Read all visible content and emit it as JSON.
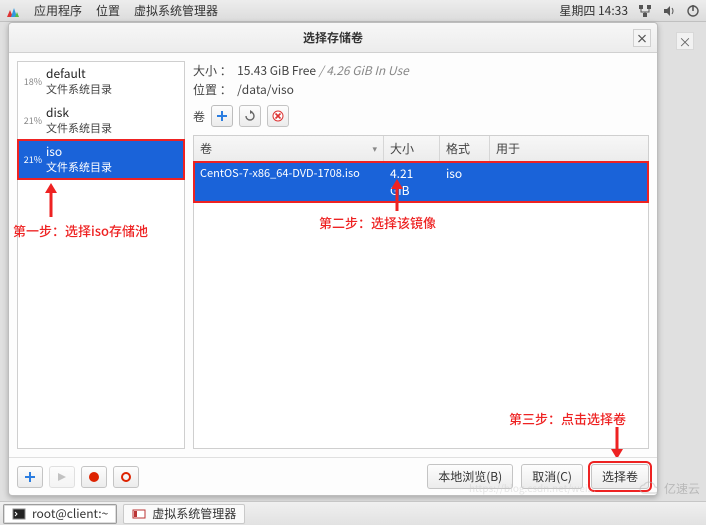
{
  "topbar": {
    "menus": [
      "应用程序",
      "位置",
      "虚拟系统管理器"
    ],
    "clock": "星期四 14:33"
  },
  "dialog": {
    "title": "选择存储卷",
    "info": {
      "size_label": "大小 ：",
      "size_free": "15.43 GiB Free",
      "size_used": "4.26 GiB In Use",
      "loc_label": "位置 ：",
      "loc_value": "/data/viso"
    },
    "vol_toolbar_label": "卷",
    "pools": [
      {
        "pct": "18%",
        "name": "default",
        "desc": "文件系统目录",
        "selected": false
      },
      {
        "pct": "21%",
        "name": "disk",
        "desc": "文件系统目录",
        "selected": false
      },
      {
        "pct": "21%",
        "name": "iso",
        "desc": "文件系统目录",
        "selected": true
      }
    ],
    "columns": {
      "name": "卷",
      "size": "大小",
      "fmt": "格式",
      "use": "用于"
    },
    "rows": [
      {
        "name": "CentOS-7-x86_64-DVD-1708.iso",
        "size": "4.21 GiB",
        "fmt": "iso",
        "use": ""
      }
    ],
    "footer": {
      "browse": "本地浏览(B)",
      "cancel": "取消(C)",
      "choose": "选择卷"
    }
  },
  "annotations": {
    "step1": "第一步：选择iso存储池",
    "step2": "第二步：选择该镜像",
    "step3": "第三步：点击选择卷"
  },
  "taskbar": {
    "term": "root@client:~",
    "vmm": "虚拟系统管理器"
  },
  "watermark": "亿速云"
}
